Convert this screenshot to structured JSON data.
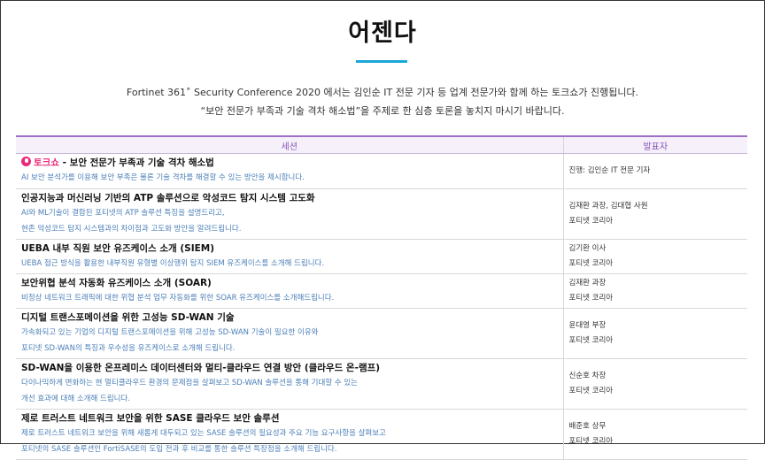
{
  "page": {
    "title": "어젠다",
    "intro_line1": "Fortinet 361˚ Security Conference 2020 에서는 김인순 IT 전문 기자 등 업계 전문가와 함께 하는 토크쇼가 진행됩니다.",
    "intro_line2": "“보안 전문가 부족과 기술 격차 해소법”을 주제로 한 심층 토론을 놓치지 마시기 바랍니다."
  },
  "table": {
    "headers": {
      "session": "세션",
      "speaker": "발표자"
    },
    "rows": [
      {
        "badge": "토크쇼",
        "title": " - 보안 전문가 부족과 기술 격차 해소법",
        "desc": [
          "AI 보안 분석가를 이용해 보안 부족은 물론 기술 격차를 해결할 수 있는 방안을 제시합니다."
        ],
        "speaker": [
          "진행: 김인순 IT 전문 기자"
        ]
      },
      {
        "title": "인공지능과 머신러닝 기반의 ATP 솔루션으로 악성코드 탐지 시스템 고도화",
        "desc": [
          "AI와 ML기술이 결합된 포티넷의 ATP 솔루션 특징을 설명드리고,",
          "현존 악성코드 탐지 시스템과의 차이점과 고도화 방안을 알려드립니다."
        ],
        "speaker": [
          "김재환 과장, 김대협 사원",
          "포티넷 코리아"
        ]
      },
      {
        "title": "UEBA 내부 직원 보안 유즈케이스 소개 (SIEM)",
        "desc": [
          "UEBA 접근 방식을 활용한 내부직원 유형별 이상행위 탐지 SIEM 유즈케이스를 소개해 드립니다."
        ],
        "speaker": [
          "김기환 이사",
          "포티넷 코리아"
        ]
      },
      {
        "title": "보안위협 분석 자동화 유즈케이스 소개 (SOAR)",
        "desc": [
          "비정상 네트워크 트래픽에 대한 위협 분석 업무 자동화를 위한 SOAR 유즈케이스를 소개해드립니다."
        ],
        "speaker": [
          "김재환 과장",
          "포티넷 코리아"
        ]
      },
      {
        "title": "디지털 트랜스포메이션을 위한 고성능 SD-WAN 기술",
        "desc": [
          "가속화되고 있는 기업의 디지털 트랜스포메이션을 위해 고성능 SD-WAN 기술이 필요한 이유와",
          "포티넷 SD-WAN의 특징과 우수성을 유즈케이스로 소개해 드립니다."
        ],
        "speaker": [
          "윤대영 부장",
          "포티넷 코리아"
        ]
      },
      {
        "title": "SD-WAN을 이용한 온프레미스 데이터센터와 멀티-클라우드 연결 방안 (클라우드 온-램프)",
        "desc": [
          "다이나믹하게 변화하는 현 멀티클라우드 환경의 문제점을 살펴보고 SD-WAN 솔루션을 통해 기대할 수 있는",
          "개선 효과에 대해 소개해 드립니다."
        ],
        "speaker": [
          "신순호 차장",
          "포티넷 코리아"
        ]
      },
      {
        "title": "제로 트러스트 네트워크 보안을 위한 SASE 클라우드 보안 솔루션",
        "desc": [
          "제로 트러스트 네트워크 보안을 위해 새롭게 대두되고 있는 SASE 솔루션의 필요성과 주요 기능 요구사항을 살펴보고",
          "포티넷의 SASE 솔루션인 FortiSASE의 도입 전과 후 비교를 통한 솔루션 특장점을 소개해 드립니다."
        ],
        "speaker": [
          "배준호 상무",
          "포티넷 코리아"
        ]
      }
    ]
  }
}
